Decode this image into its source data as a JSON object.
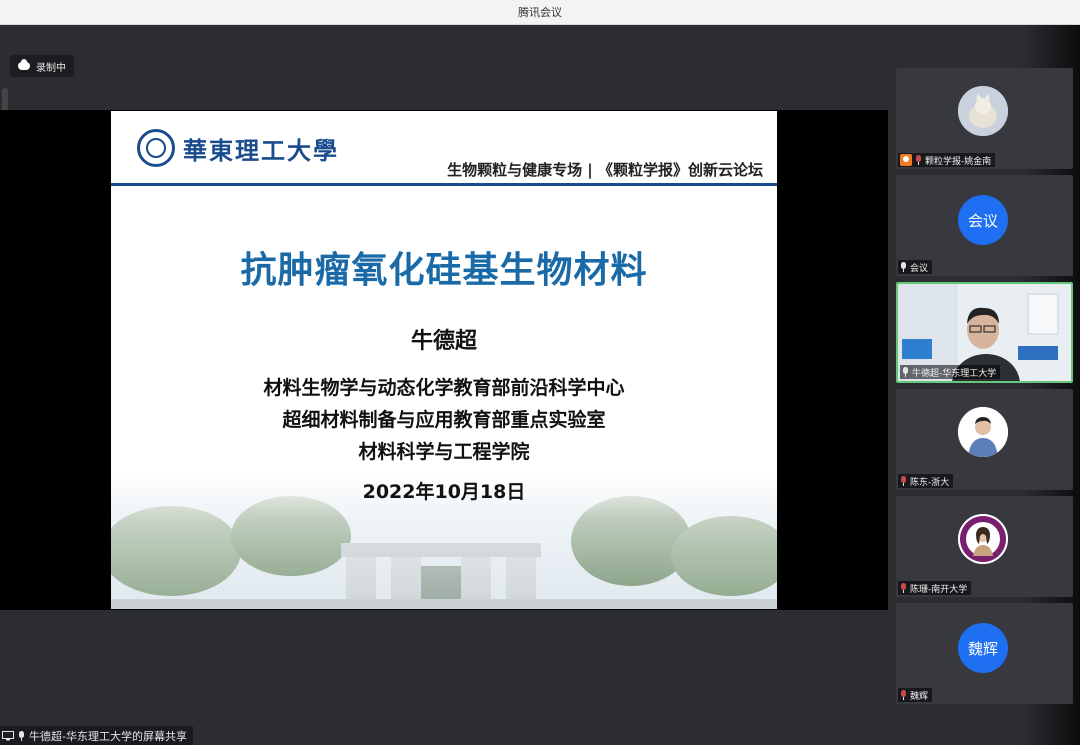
{
  "window": {
    "title": "腾讯会议"
  },
  "recording": {
    "label": "录制中"
  },
  "audio_level": {
    "fraction": 0.45
  },
  "slide": {
    "logo_text": "華東理工大學",
    "forum_title": "生物颗粒与健康专场 | 《颗粒学报》创新云论坛",
    "title": "抗肿瘤氧化硅基生物材料",
    "speaker": "牛德超",
    "affiliations": [
      "材料生物学与动态化学教育部前沿科学中心",
      "超细材料制备与应用教育部重点实验室",
      "材料科学与工程学院"
    ],
    "date": "2022年10月18日"
  },
  "screen_share": {
    "label": "牛德超-华东理工大学的屏幕共享"
  },
  "participants": [
    {
      "name": "颗粒学报-姚金南",
      "avatar_text": "",
      "type": "photo",
      "host": true,
      "muted": true
    },
    {
      "name": "会议",
      "avatar_text": "会议",
      "type": "initials",
      "host": false,
      "muted": false
    },
    {
      "name": "牛德超-华东理工大学",
      "avatar_text": "",
      "type": "video",
      "host": false,
      "muted": false,
      "active": true
    },
    {
      "name": "陈东-浙大",
      "avatar_text": "",
      "type": "photo",
      "host": false,
      "muted": true
    },
    {
      "name": "陈珊-南开大学",
      "avatar_text": "",
      "type": "photo",
      "host": false,
      "muted": true
    },
    {
      "name": "魏辉",
      "avatar_text": "魏辉",
      "type": "initials",
      "host": false,
      "muted": true
    }
  ],
  "colors": {
    "accent": "#1f6ff2",
    "active_border": "#66c57a",
    "slide_title": "#1a6aa8",
    "ecust_blue": "#1a4b8c"
  }
}
